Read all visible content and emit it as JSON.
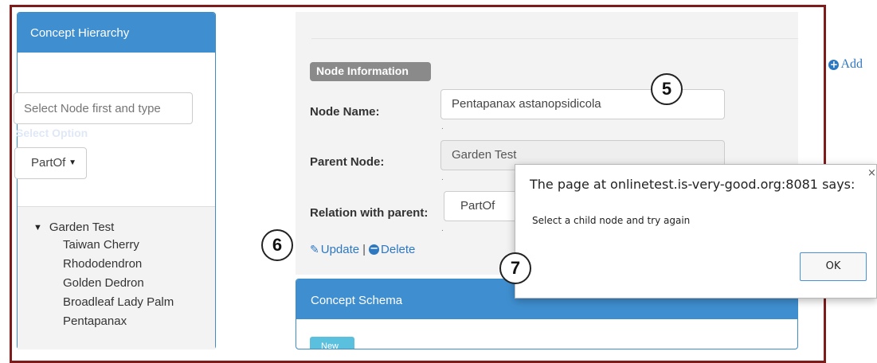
{
  "left_panel": {
    "title": "Concept Hierarchy",
    "add_label": "Add",
    "node_input_placeholder": "Select Node first and type",
    "select_option_label": "Select Option",
    "relation_select_value": "PartOf",
    "tree": {
      "root": "Garden Test",
      "children": [
        "Taiwan Cherry",
        "Rhododendron",
        "Golden Dedron",
        "Broadleaf Lady Palm",
        "Pentapanax"
      ]
    }
  },
  "node_info": {
    "badge": "Node Information",
    "node_name_label": "Node Name:",
    "node_name_value": "Pentapanax astanopsidicola",
    "parent_node_label": "Parent Node:",
    "parent_node_value": "Garden Test",
    "relation_label": "Relation with parent:",
    "relation_value": "PartOf",
    "dot": ".",
    "update_label": "Update",
    "separator": "|",
    "delete_label": "Delete"
  },
  "schema_panel": {
    "title": "Concept Schema",
    "new_button": "New"
  },
  "dialog": {
    "title": "The page at onlinetest.is-very-good.org:8081 says:",
    "message": "Select a child node and try again",
    "ok_label": "OK",
    "close_glyph": "×"
  },
  "callouts": {
    "c5": "5",
    "c6": "6",
    "c7": "7"
  },
  "colors": {
    "panel_header": "#3f8fd0",
    "link": "#2e78c1",
    "frame": "#7e1c1c",
    "badge": "#8a8a8a",
    "new_button": "#5bc0de"
  },
  "icons": [
    "plus-circle-icon",
    "caret-down-icon",
    "tree-expand-triangle-icon",
    "pencil-icon",
    "minus-circle-icon",
    "close-icon"
  ]
}
